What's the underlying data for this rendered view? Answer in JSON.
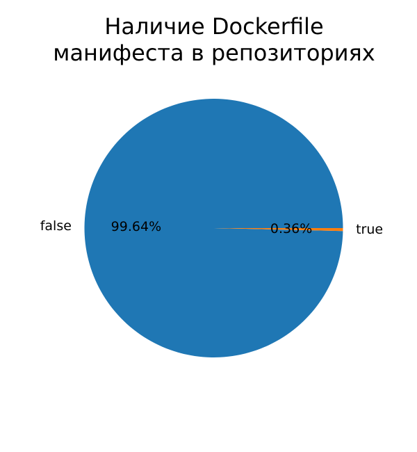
{
  "chart_data": {
    "type": "pie",
    "title_lines": [
      "Наличие Dockerfile",
      "манифеста в репозиториях"
    ],
    "slices": [
      {
        "label": "false",
        "value": 99.64,
        "pct_label": "99.64%",
        "color": "#1f77b4"
      },
      {
        "label": "true",
        "value": 0.36,
        "pct_label": "0.36%",
        "color": "#ff7f0e"
      }
    ],
    "start_angle_deg": 0,
    "direction": "counterclockwise",
    "legend": false
  }
}
